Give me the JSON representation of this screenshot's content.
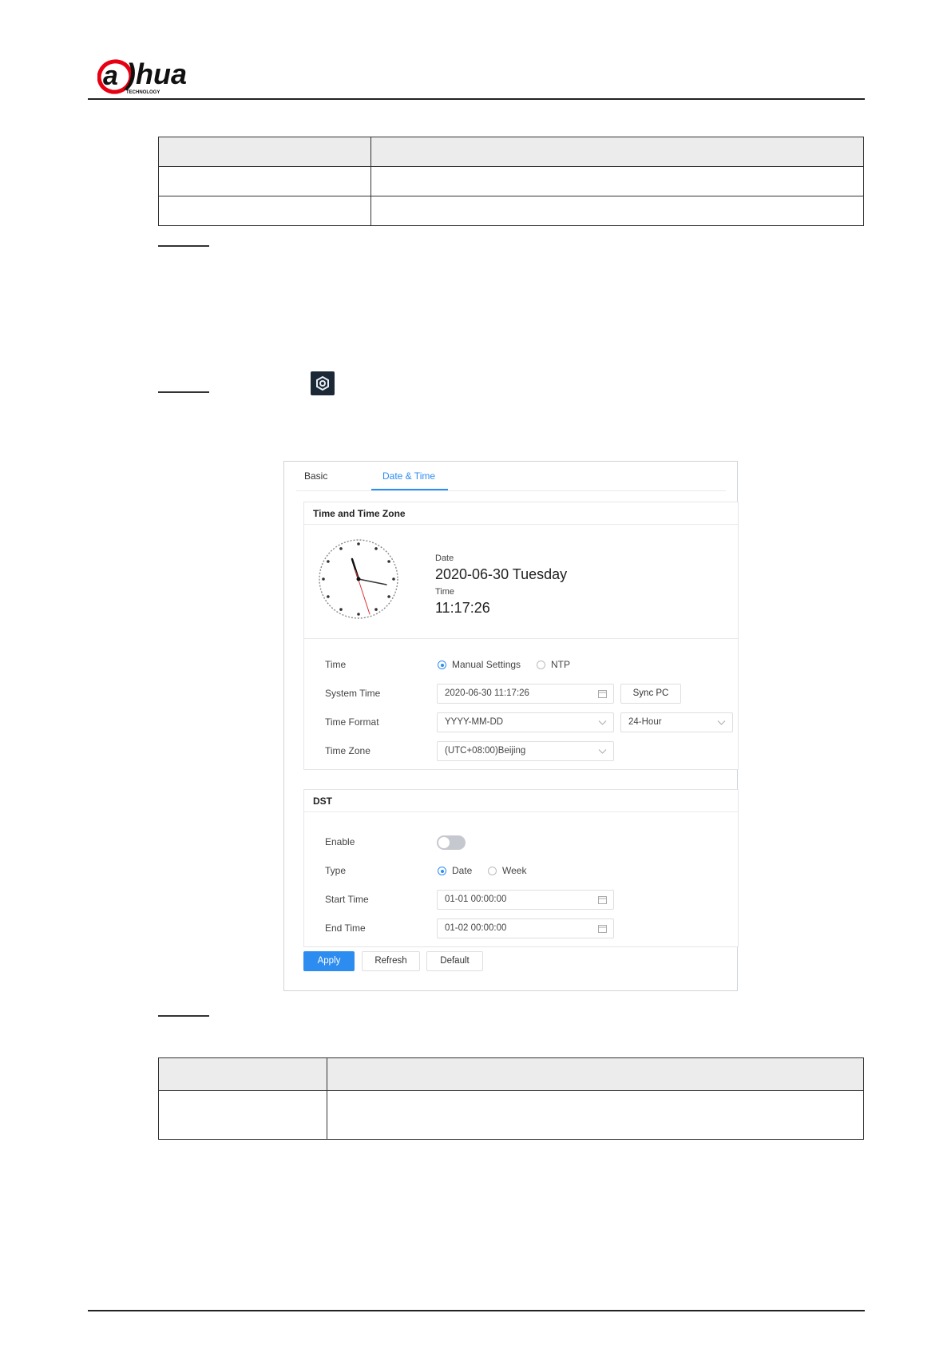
{
  "tabs": {
    "basic": "Basic",
    "date_time": "Date & Time"
  },
  "time_zone_section": {
    "title": "Time and Time Zone",
    "date_label": "Date",
    "date_value": "2020-06-30 Tuesday",
    "time_label": "Time",
    "time_value": "11:17:26",
    "rows": {
      "time_label": "Time",
      "manual": "Manual Settings",
      "ntp": "NTP",
      "system_time_label": "System Time",
      "system_time_value": "2020-06-30 11:17:26",
      "sync_pc": "Sync PC",
      "time_format_label": "Time Format",
      "date_format": "YYYY-MM-DD",
      "hour_format": "24-Hour",
      "time_zone_label": "Time Zone",
      "time_zone_value": "(UTC+08:00)Beijing"
    }
  },
  "dst_section": {
    "title": "DST",
    "enable_label": "Enable",
    "enabled": false,
    "type_label": "Type",
    "type_date": "Date",
    "type_week": "Week",
    "start_label": "Start Time",
    "start_value": "01-01 00:00:00",
    "end_label": "End Time",
    "end_value": "01-02 00:00:00"
  },
  "buttons": {
    "apply": "Apply",
    "refresh": "Refresh",
    "default": "Default"
  },
  "colors": {
    "accent": "#2d8cf0",
    "brand": "#e60012"
  },
  "icons": {
    "settings": "gear-icon",
    "calendar": "calendar-icon",
    "dropdown": "chevron-down-icon"
  }
}
